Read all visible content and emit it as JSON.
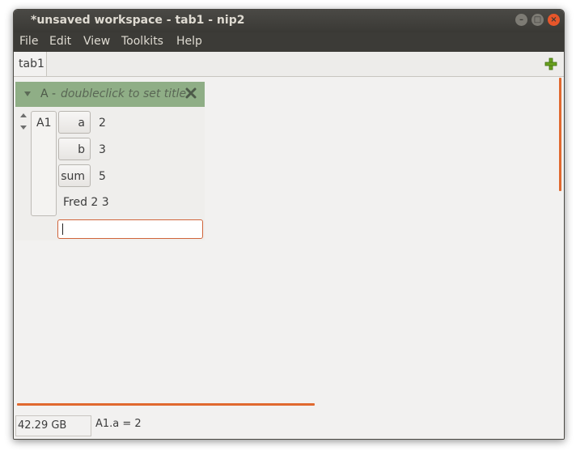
{
  "window": {
    "title": "*unsaved workspace - tab1 - nip2"
  },
  "menubar": {
    "items": [
      "File",
      "Edit",
      "View",
      "Toolkits",
      "Help"
    ]
  },
  "tabs": {
    "active": "tab1",
    "add_icon": "plus-icon"
  },
  "column": {
    "name": "A -",
    "title_placeholder": "doubleclick to set title",
    "row_name": "A1",
    "members": [
      {
        "label": "a",
        "value": "2"
      },
      {
        "label": "b",
        "value": "3"
      },
      {
        "label": "sum",
        "value": "5"
      }
    ],
    "result_text": "Fred 2 3",
    "entry_value": ""
  },
  "statusbar": {
    "disk_free": "42.29 GB free",
    "message": "A1.a = 2"
  },
  "colors": {
    "column_header": "#8fae86",
    "accent": "#e0692f",
    "titlebar": "#3c3b37"
  }
}
